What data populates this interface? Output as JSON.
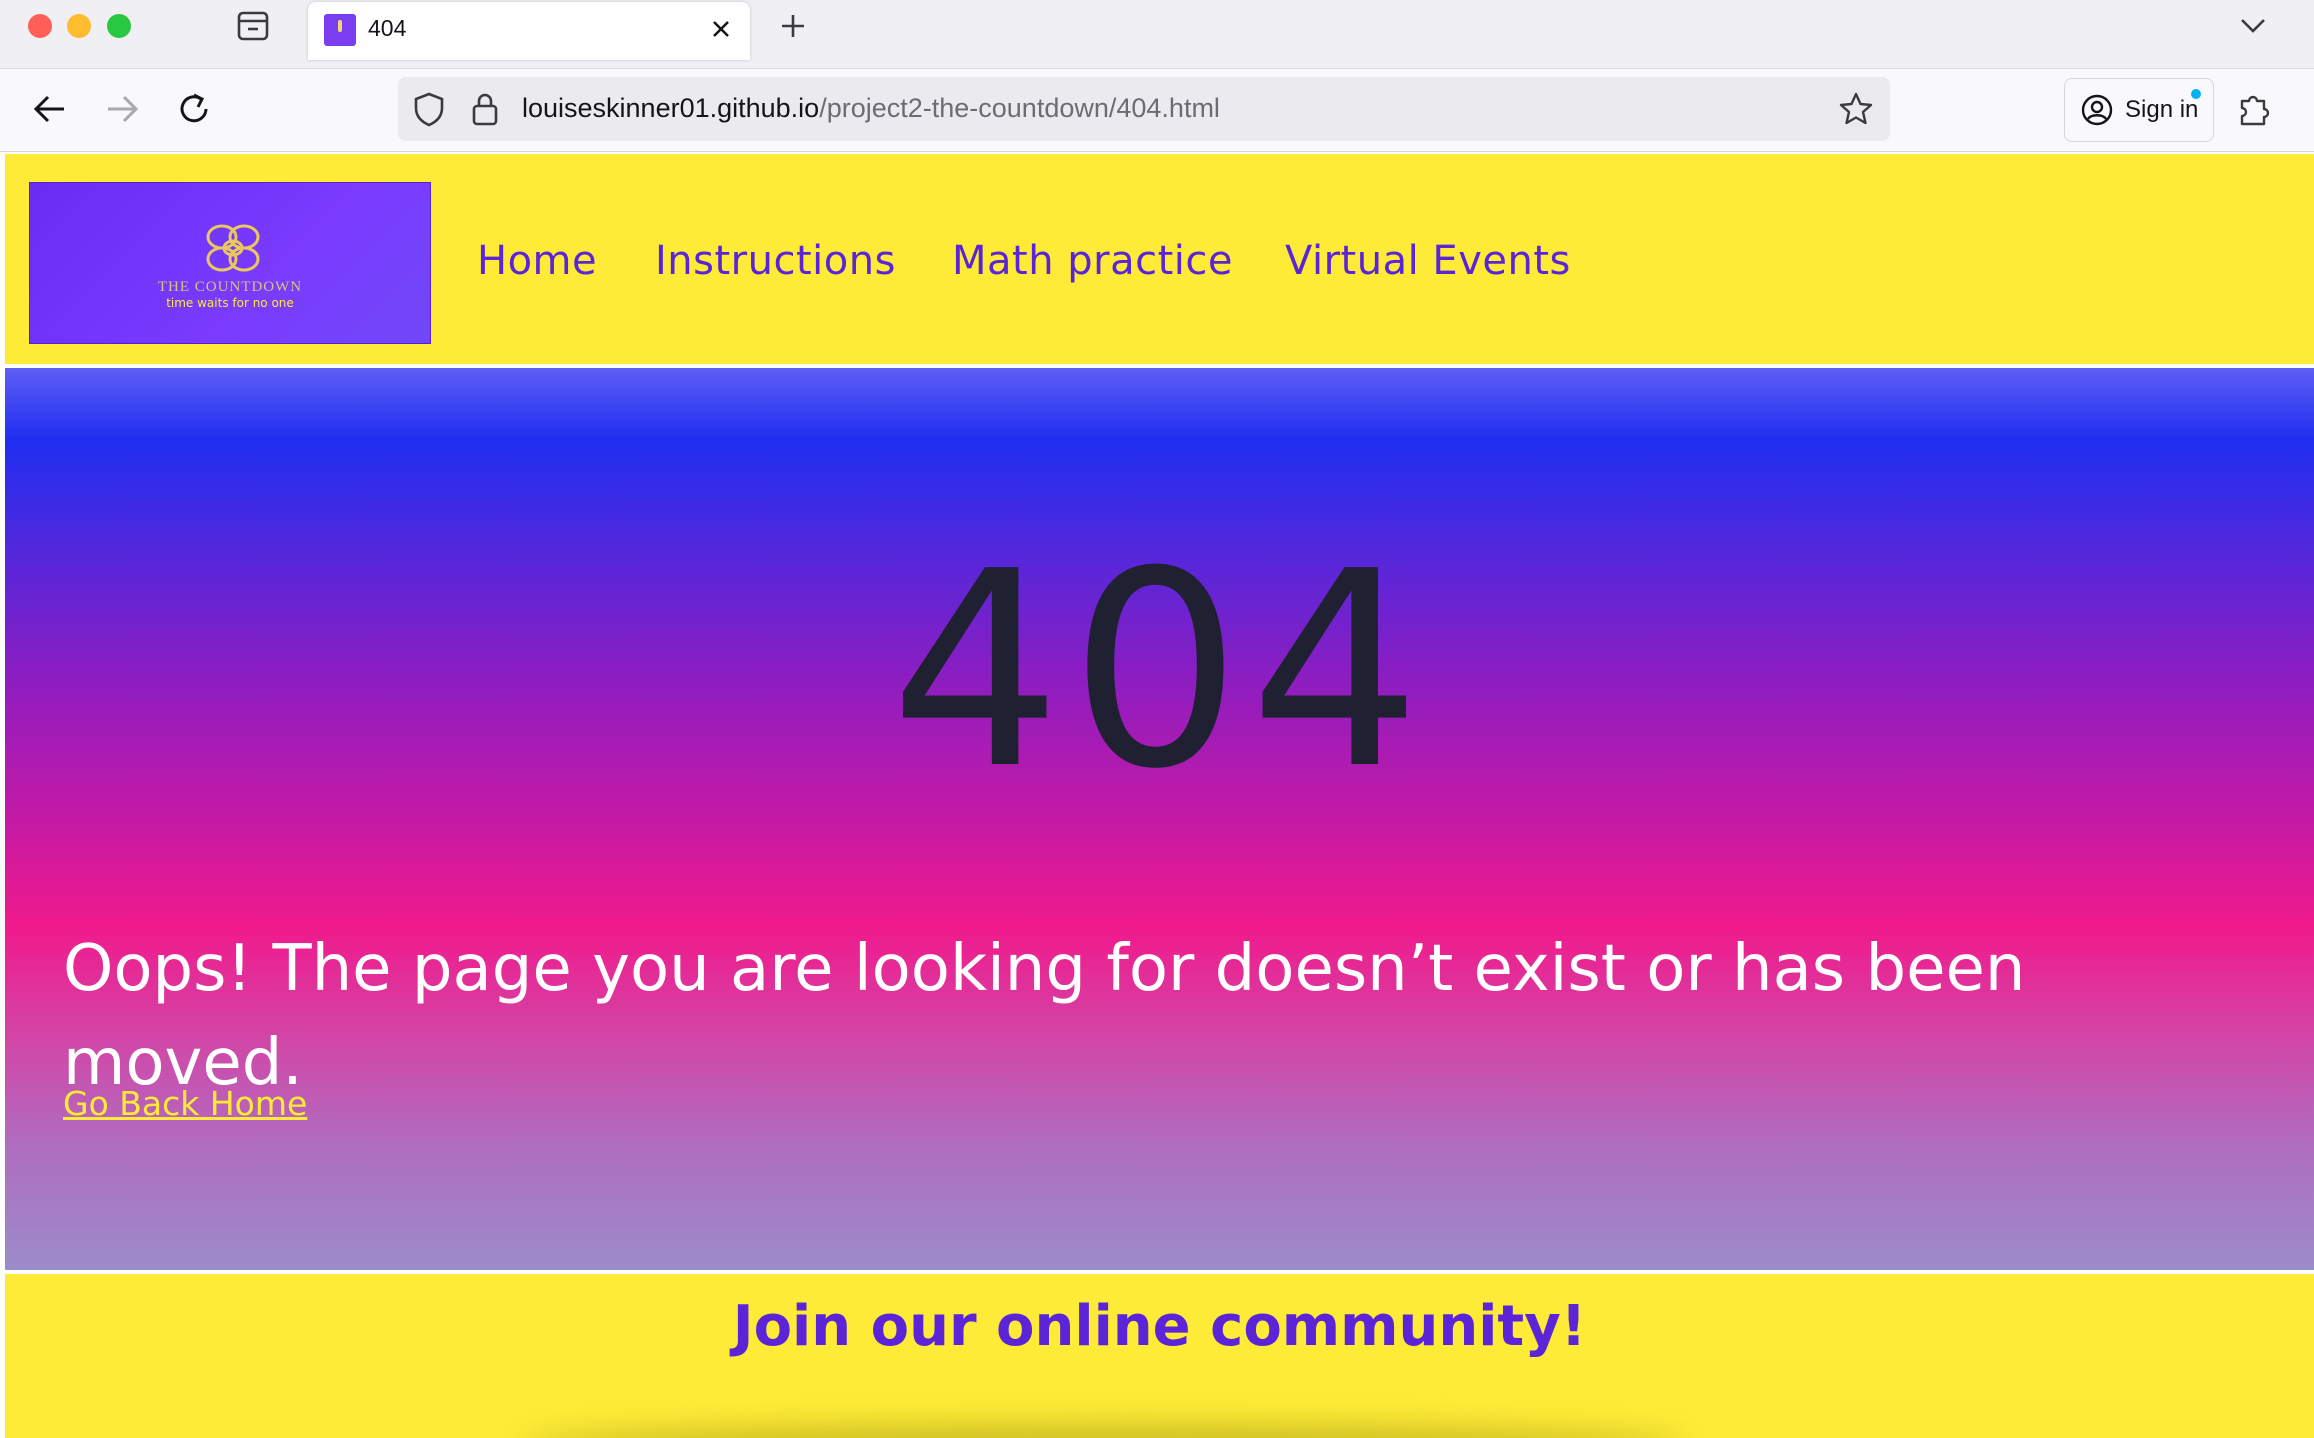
{
  "browser": {
    "tab": {
      "title": "404"
    },
    "url": {
      "domain": "louiseskinner01.github.io",
      "path": "/project2-the-countdown/404.html"
    },
    "signin_label": "Sign in"
  },
  "site": {
    "logo": {
      "title": "THE COUNTDOWN",
      "tagline": "time waits for no one"
    },
    "nav": [
      "Home",
      "Instructions",
      "Math practice",
      "Virtual Events"
    ],
    "hero": {
      "code": "404",
      "message": "Oops! The page you are looking for doesn’t exist or has been moved.",
      "link": "Go Back Home"
    },
    "community_heading": "Join our online community!"
  },
  "colors": {
    "header_bg": "#fdeb37",
    "nav_link": "#5b24d8",
    "logo_bg": "#6a2cf3",
    "link_yellow": "#fdeb37"
  }
}
